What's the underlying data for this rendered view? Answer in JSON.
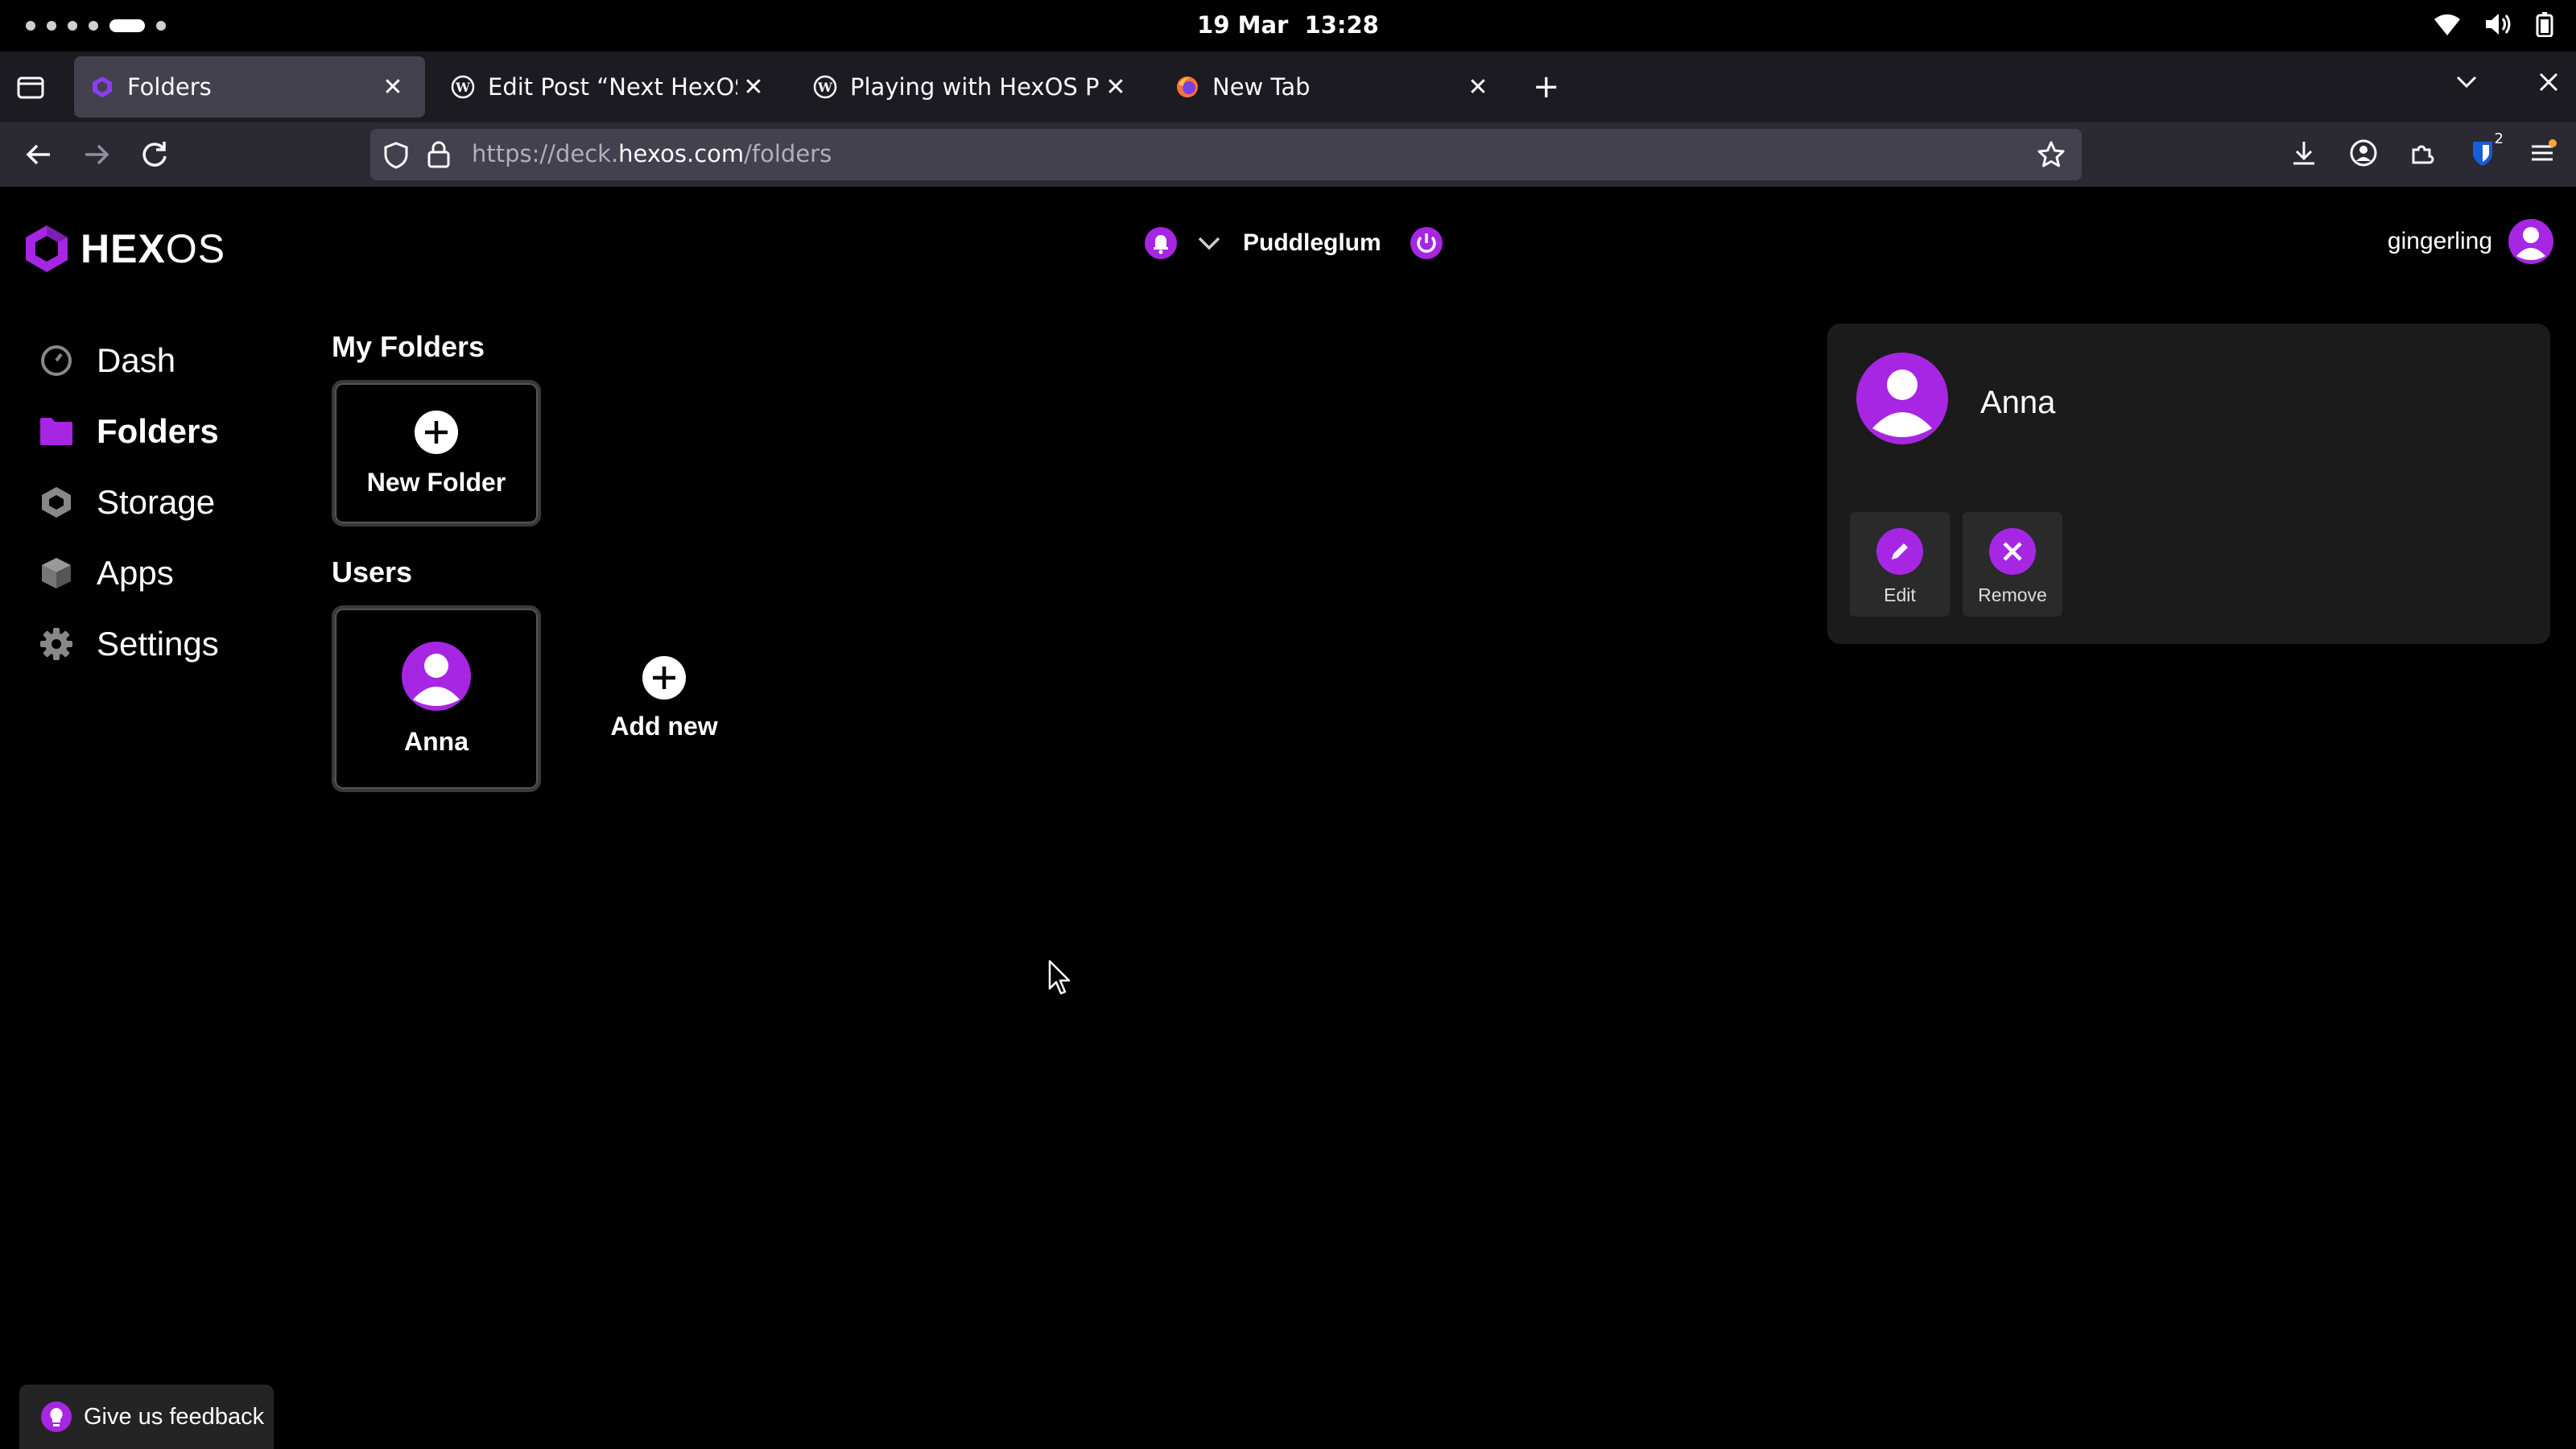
{
  "system": {
    "date": "19 Mar",
    "time": "13:28"
  },
  "browser": {
    "tabs": [
      {
        "title": "Folders",
        "favicon": "hexos-icon",
        "active": true
      },
      {
        "title": "Edit Post “Next HexOS” ‹ /",
        "favicon": "wordpress-icon",
        "active": false
      },
      {
        "title": "Playing with HexOS Part 1",
        "favicon": "wordpress-icon",
        "active": false
      },
      {
        "title": "New Tab",
        "favicon": "firefox-icon",
        "active": false
      }
    ],
    "new_tab_label": "+",
    "url_prefix": "https://deck.",
    "url_domain": "hexos.com",
    "url_path": "/folders",
    "extension_badge": "2"
  },
  "app": {
    "logo_hex": "HEX",
    "logo_os": "OS",
    "server_name": "Puddleglum",
    "username": "gingerling",
    "accent_color": "#a626e3",
    "sidebar": [
      {
        "label": "Dash",
        "icon": "gauge-icon"
      },
      {
        "label": "Folders",
        "icon": "folder-icon",
        "active": true
      },
      {
        "label": "Storage",
        "icon": "hexagon-icon"
      },
      {
        "label": "Apps",
        "icon": "cube-icon"
      },
      {
        "label": "Settings",
        "icon": "gear-icon"
      }
    ],
    "my_folders": {
      "title": "My Folders",
      "new_folder_label": "New Folder"
    },
    "users": {
      "title": "Users",
      "items": [
        {
          "name": "Anna"
        }
      ],
      "add_new_label": "Add new"
    },
    "detail": {
      "name": "Anna",
      "edit_label": "Edit",
      "remove_label": "Remove"
    },
    "feedback_label": "Give us feedback"
  }
}
